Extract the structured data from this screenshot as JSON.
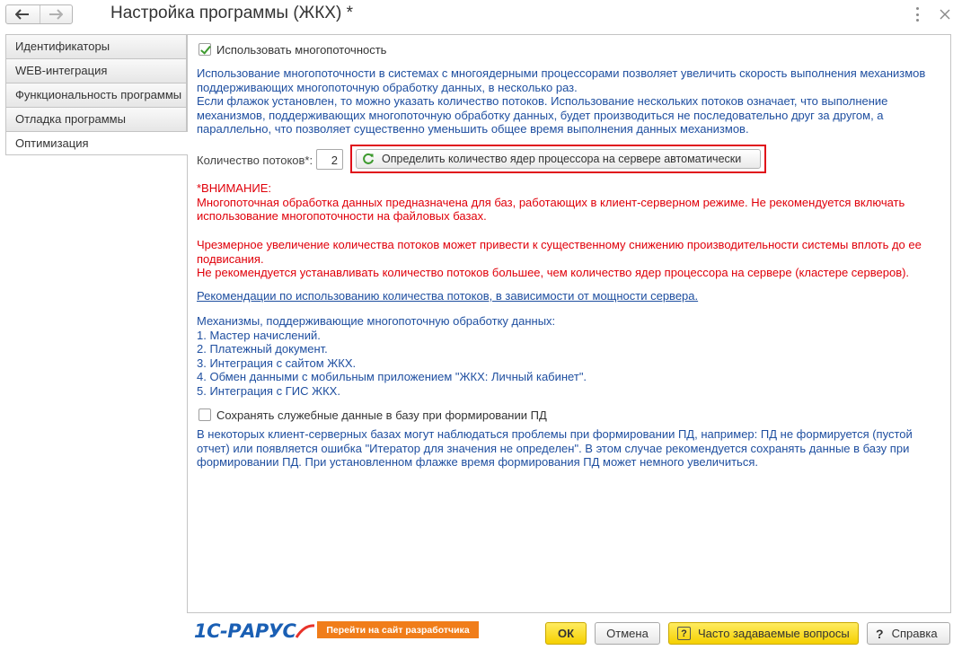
{
  "window": {
    "title": "Настройка программы (ЖКХ) *"
  },
  "tabs": [
    {
      "label": "Идентификаторы",
      "active": false
    },
    {
      "label": "WEB-интеграция",
      "active": false
    },
    {
      "label": "Функциональность программы",
      "active": false
    },
    {
      "label": "Отладка программы",
      "active": false
    },
    {
      "label": "Оптимизация",
      "active": true
    }
  ],
  "multithreading": {
    "checkbox_label": "Использовать многопоточность",
    "checked": true,
    "description": [
      "Использование многопоточности в системах с многоядерными процессорами позволяет увеличить скорость выполнения механизмов",
      "поддерживающих многопоточную обработку данных, в несколько раз.",
      "Если флажок установлен, то можно указать количество потоков. Использование нескольких потоков означает, что выполнение",
      "механизмов, поддерживающих многопоточную обработку данных, будет производиться не последовательно друг за другом, а",
      "параллельно, что позволяет существенно уменьшить общее время выполнения данных механизмов."
    ],
    "threads_label": "Количество потоков*:",
    "threads_value": "2",
    "detect_button_label": "Определить количество ядер процессора на сервере автоматически"
  },
  "warning": {
    "lines_1": [
      "*ВНИМАНИЕ:",
      "Многопоточная обработка данных предназначена для баз, работающих в клиент-серверном режиме. Не рекомендуется включать",
      "использование многопоточности на файловых базах."
    ],
    "lines_2": [
      "Чрезмерное увеличение количества потоков может привести к существенному снижению производительности системы вплоть до ее",
      "подвисания.",
      "Не рекомендуется устанавливать количество потоков большее, чем количество ядер процессора на сервере (кластере серверов)."
    ]
  },
  "recommendations_link": "Рекомендации по использованию количества потоков, в зависимости от мощности сервера.",
  "mechanisms": [
    "Механизмы, поддерживающие многопоточную обработку данных:",
    "1. Мастер начислений.",
    "2. Платежный документ.",
    "3. Интеграция с сайтом ЖКХ.",
    "4. Обмен данными с мобильным приложением \"ЖКХ: Личный кабинет\".",
    "5. Интеграция с ГИС ЖКХ."
  ],
  "save_service": {
    "checkbox_label": "Сохранять служебные данные в базу при формировании ПД",
    "checked": false,
    "description": [
      "В некоторых клиент-серверных базах могут наблюдаться проблемы при формировании ПД, например: ПД не формируется (пустой",
      "отчет) или появляется ошибка \"Итератор для значения не определен\". В этом случае рекомендуется сохранять данные в базу при",
      "формировании ПД. При установленном флажке время формирования ПД может немного увеличиться."
    ]
  },
  "footer": {
    "logo_text": "1С-РАРУС",
    "dev_site_label": "Перейти на сайт разработчика",
    "ok_label": "ОК",
    "cancel_label": "Отмена",
    "faq_label": "Часто задаваемые вопросы",
    "help_label": "Справка"
  },
  "colors": {
    "info_text": "#1f4fa0",
    "warning_text": "#e0000a",
    "highlight_border": "#e0101a",
    "accent_yellow": "#f5d000",
    "dev_button": "#f07d1a"
  }
}
